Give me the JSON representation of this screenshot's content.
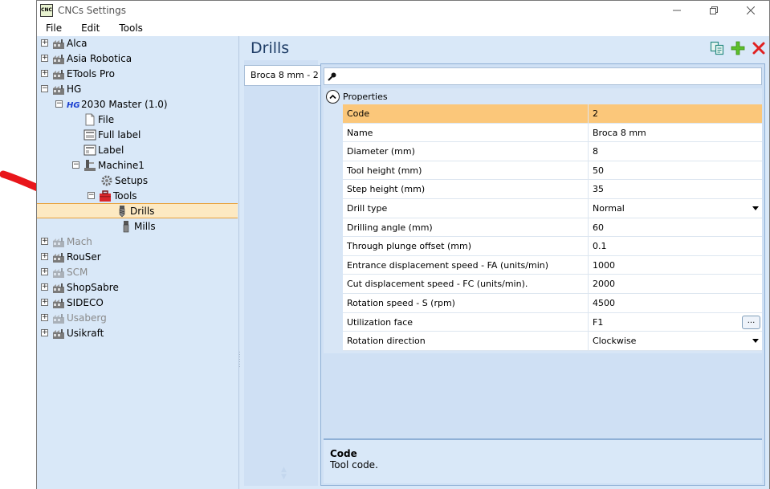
{
  "window": {
    "title": "CNCs Settings",
    "app_icon_text": "CNC"
  },
  "menu": [
    "File",
    "Edit",
    "Tools"
  ],
  "tree": {
    "manufacturers": [
      {
        "label": "Alca",
        "disabled": false
      },
      {
        "label": "Asia Robotica",
        "disabled": false
      },
      {
        "label": "ETools Pro",
        "disabled": false
      },
      {
        "label": "HG",
        "disabled": false
      },
      {
        "label": "Mach",
        "disabled": true
      },
      {
        "label": "RouSer",
        "disabled": false
      },
      {
        "label": "SCM",
        "disabled": true
      },
      {
        "label": "ShopSabre",
        "disabled": false
      },
      {
        "label": "SIDECO",
        "disabled": false
      },
      {
        "label": "Usaberg",
        "disabled": true
      },
      {
        "label": "Usikraft",
        "disabled": false
      }
    ],
    "hg_children": {
      "model": "2030 Master (1.0)",
      "file": "File",
      "full_label": "Full label",
      "label": "Label",
      "machine": "Machine1",
      "setups": "Setups",
      "tools": "Tools",
      "drills": "Drills",
      "mills": "Mills"
    }
  },
  "right": {
    "title": "Drills",
    "tab_label": "Broca 8 mm - 2",
    "search_placeholder": "",
    "category": "Properties",
    "properties": [
      {
        "name": "Code",
        "value": "2"
      },
      {
        "name": "Name",
        "value": "Broca 8 mm"
      },
      {
        "name": "Diameter (mm)",
        "value": "8"
      },
      {
        "name": "Tool height (mm)",
        "value": "50"
      },
      {
        "name": "Step height (mm)",
        "value": "35"
      },
      {
        "name": "Drill type",
        "value": "Normal"
      },
      {
        "name": "Drilling angle (mm)",
        "value": "60"
      },
      {
        "name": "Through plunge offset (mm)",
        "value": "0.1"
      },
      {
        "name": "Entrance displacement speed - FA (units/min)",
        "value": "1000"
      },
      {
        "name": "Cut displacement speed - FC (units/min).",
        "value": "2000"
      },
      {
        "name": "Rotation speed - S (rpm)",
        "value": "4500"
      },
      {
        "name": "Utilization face",
        "value": "F1"
      },
      {
        "name": "Rotation direction",
        "value": "Clockwise"
      }
    ],
    "ellipsis_label": "...",
    "help": {
      "title": "Code",
      "description": "Tool code."
    }
  },
  "colors": {
    "selection": "#fbc77a",
    "tree_bg": "#d9e8f8",
    "accent_title": "#1f3d66",
    "annotation_arrow": "#e8161b"
  }
}
